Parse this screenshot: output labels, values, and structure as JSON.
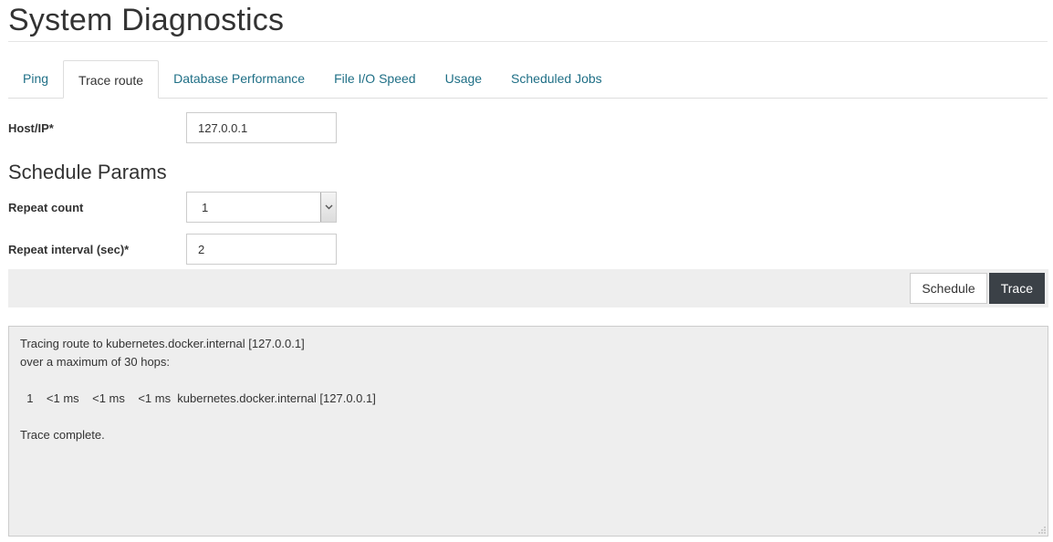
{
  "page": {
    "title": "System Diagnostics"
  },
  "tabs": [
    {
      "label": "Ping",
      "active": false
    },
    {
      "label": "Trace route",
      "active": true
    },
    {
      "label": "Database Performance",
      "active": false
    },
    {
      "label": "File I/O Speed",
      "active": false
    },
    {
      "label": "Usage",
      "active": false
    },
    {
      "label": "Scheduled Jobs",
      "active": false
    }
  ],
  "form": {
    "host_label": "Host/IP*",
    "host_value": "127.0.0.1",
    "schedule_heading": "Schedule Params",
    "repeat_count_label": "Repeat count",
    "repeat_count_value": "1",
    "repeat_interval_label": "Repeat interval (sec)*",
    "repeat_interval_value": "2"
  },
  "actions": {
    "schedule_label": "Schedule",
    "trace_label": "Trace"
  },
  "output": {
    "lines": [
      "Tracing route to kubernetes.docker.internal [127.0.0.1]",
      "over a maximum of 30 hops:",
      "",
      "  1    <1 ms    <1 ms    <1 ms  kubernetes.docker.internal [127.0.0.1]",
      "",
      "Trace complete."
    ]
  },
  "colors": {
    "link": "#1f6f86",
    "primary_button": "#3b4147",
    "panel_bg": "#eeeeee"
  }
}
